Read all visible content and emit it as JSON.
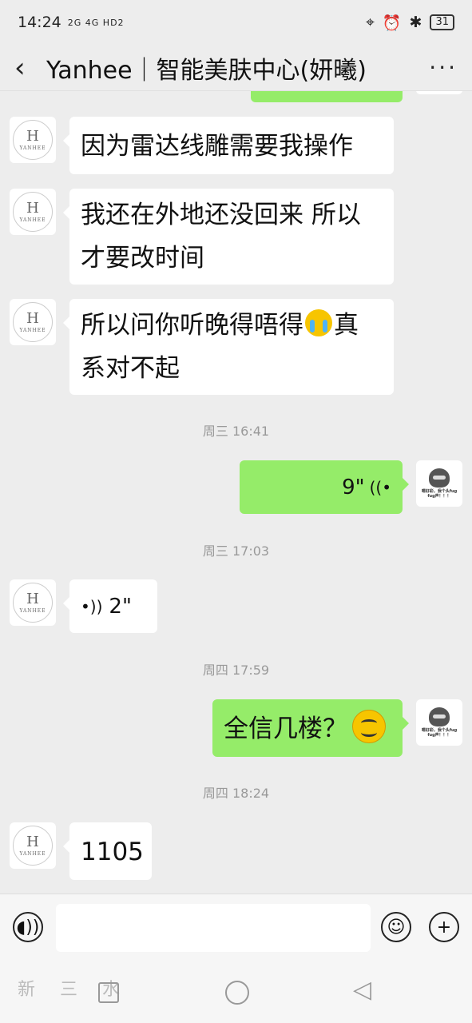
{
  "status_bar": {
    "time": "14:24",
    "network_left": "2G 4G HD2",
    "battery": "31"
  },
  "header": {
    "title": "Yanhee｜智能美肤中心(妍曦)"
  },
  "avatars": {
    "contact_logo_letter": "H",
    "contact_logo_word": "YANHEE",
    "me_caption": "嗯好彩，我个头fug fug声！！！"
  },
  "messages": [
    {
      "type": "text",
      "from": "contact",
      "text": "因为雷达线雕需要我操作"
    },
    {
      "type": "text",
      "from": "contact",
      "text": "我还在外地还没回来 所以才要改时间"
    },
    {
      "type": "text",
      "from": "contact",
      "text_a": "所以问你听晚得唔得",
      "text_b": "真系对不起",
      "emoji": "loudly-crying"
    },
    {
      "type": "timestamp",
      "text": "周三 16:41"
    },
    {
      "type": "voice",
      "from": "me",
      "duration": "9\""
    },
    {
      "type": "timestamp",
      "text": "周三 17:03"
    },
    {
      "type": "voice",
      "from": "contact",
      "duration": "2\""
    },
    {
      "type": "timestamp",
      "text": "周四 17:59"
    },
    {
      "type": "text",
      "from": "me",
      "text": "全信几楼？",
      "emoji": "smiling"
    },
    {
      "type": "timestamp",
      "text": "周四 18:24"
    },
    {
      "type": "text",
      "from": "contact",
      "text": "1105"
    }
  ],
  "input_bar": {
    "voice_icon": "voice-icon",
    "emoji_icon": "emoji-icon",
    "plus_icon": "plus-icon"
  },
  "watermark": "新 三 水"
}
